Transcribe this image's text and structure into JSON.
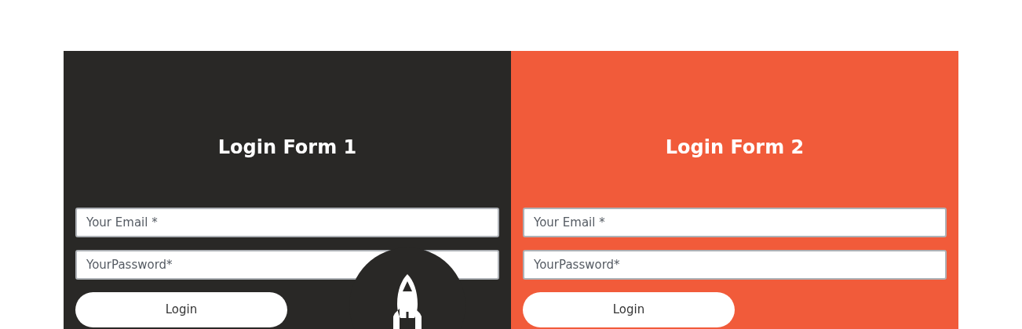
{
  "panels": [
    {
      "kind": "dark",
      "title": "Login Form 1",
      "fields": [
        {
          "placeholder": "Your Email *"
        },
        {
          "placeholder": "YourPassword*"
        }
      ],
      "button": "Login",
      "badge": true
    },
    {
      "kind": "orange",
      "title": "Login Form 2",
      "fields": [
        {
          "placeholder": "Your Email *"
        },
        {
          "placeholder": "YourPassword*"
        }
      ],
      "button": "Login",
      "badge": false
    }
  ]
}
